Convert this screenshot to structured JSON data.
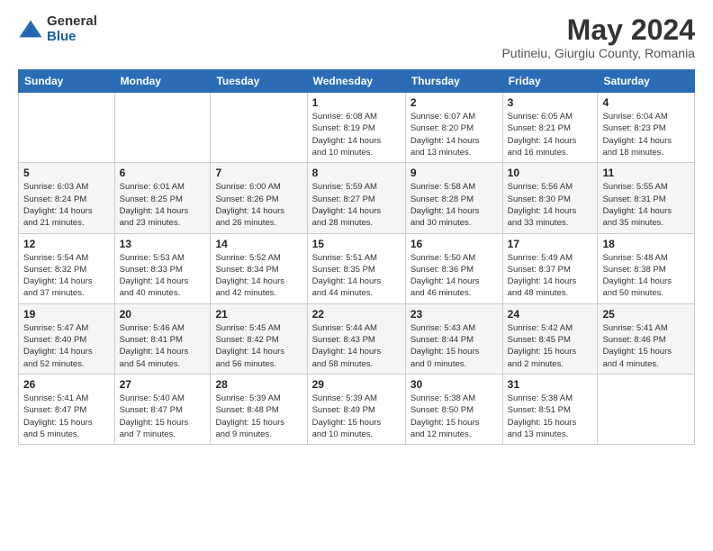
{
  "header": {
    "logo_general": "General",
    "logo_blue": "Blue",
    "month_title": "May 2024",
    "location": "Putineiu, Giurgiu County, Romania"
  },
  "weekdays": [
    "Sunday",
    "Monday",
    "Tuesday",
    "Wednesday",
    "Thursday",
    "Friday",
    "Saturday"
  ],
  "weeks": [
    [
      {
        "day": "",
        "detail": ""
      },
      {
        "day": "",
        "detail": ""
      },
      {
        "day": "",
        "detail": ""
      },
      {
        "day": "1",
        "detail": "Sunrise: 6:08 AM\nSunset: 8:19 PM\nDaylight: 14 hours\nand 10 minutes."
      },
      {
        "day": "2",
        "detail": "Sunrise: 6:07 AM\nSunset: 8:20 PM\nDaylight: 14 hours\nand 13 minutes."
      },
      {
        "day": "3",
        "detail": "Sunrise: 6:05 AM\nSunset: 8:21 PM\nDaylight: 14 hours\nand 16 minutes."
      },
      {
        "day": "4",
        "detail": "Sunrise: 6:04 AM\nSunset: 8:23 PM\nDaylight: 14 hours\nand 18 minutes."
      }
    ],
    [
      {
        "day": "5",
        "detail": "Sunrise: 6:03 AM\nSunset: 8:24 PM\nDaylight: 14 hours\nand 21 minutes."
      },
      {
        "day": "6",
        "detail": "Sunrise: 6:01 AM\nSunset: 8:25 PM\nDaylight: 14 hours\nand 23 minutes."
      },
      {
        "day": "7",
        "detail": "Sunrise: 6:00 AM\nSunset: 8:26 PM\nDaylight: 14 hours\nand 26 minutes."
      },
      {
        "day": "8",
        "detail": "Sunrise: 5:59 AM\nSunset: 8:27 PM\nDaylight: 14 hours\nand 28 minutes."
      },
      {
        "day": "9",
        "detail": "Sunrise: 5:58 AM\nSunset: 8:28 PM\nDaylight: 14 hours\nand 30 minutes."
      },
      {
        "day": "10",
        "detail": "Sunrise: 5:56 AM\nSunset: 8:30 PM\nDaylight: 14 hours\nand 33 minutes."
      },
      {
        "day": "11",
        "detail": "Sunrise: 5:55 AM\nSunset: 8:31 PM\nDaylight: 14 hours\nand 35 minutes."
      }
    ],
    [
      {
        "day": "12",
        "detail": "Sunrise: 5:54 AM\nSunset: 8:32 PM\nDaylight: 14 hours\nand 37 minutes."
      },
      {
        "day": "13",
        "detail": "Sunrise: 5:53 AM\nSunset: 8:33 PM\nDaylight: 14 hours\nand 40 minutes."
      },
      {
        "day": "14",
        "detail": "Sunrise: 5:52 AM\nSunset: 8:34 PM\nDaylight: 14 hours\nand 42 minutes."
      },
      {
        "day": "15",
        "detail": "Sunrise: 5:51 AM\nSunset: 8:35 PM\nDaylight: 14 hours\nand 44 minutes."
      },
      {
        "day": "16",
        "detail": "Sunrise: 5:50 AM\nSunset: 8:36 PM\nDaylight: 14 hours\nand 46 minutes."
      },
      {
        "day": "17",
        "detail": "Sunrise: 5:49 AM\nSunset: 8:37 PM\nDaylight: 14 hours\nand 48 minutes."
      },
      {
        "day": "18",
        "detail": "Sunrise: 5:48 AM\nSunset: 8:38 PM\nDaylight: 14 hours\nand 50 minutes."
      }
    ],
    [
      {
        "day": "19",
        "detail": "Sunrise: 5:47 AM\nSunset: 8:40 PM\nDaylight: 14 hours\nand 52 minutes."
      },
      {
        "day": "20",
        "detail": "Sunrise: 5:46 AM\nSunset: 8:41 PM\nDaylight: 14 hours\nand 54 minutes."
      },
      {
        "day": "21",
        "detail": "Sunrise: 5:45 AM\nSunset: 8:42 PM\nDaylight: 14 hours\nand 56 minutes."
      },
      {
        "day": "22",
        "detail": "Sunrise: 5:44 AM\nSunset: 8:43 PM\nDaylight: 14 hours\nand 58 minutes."
      },
      {
        "day": "23",
        "detail": "Sunrise: 5:43 AM\nSunset: 8:44 PM\nDaylight: 15 hours\nand 0 minutes."
      },
      {
        "day": "24",
        "detail": "Sunrise: 5:42 AM\nSunset: 8:45 PM\nDaylight: 15 hours\nand 2 minutes."
      },
      {
        "day": "25",
        "detail": "Sunrise: 5:41 AM\nSunset: 8:46 PM\nDaylight: 15 hours\nand 4 minutes."
      }
    ],
    [
      {
        "day": "26",
        "detail": "Sunrise: 5:41 AM\nSunset: 8:47 PM\nDaylight: 15 hours\nand 5 minutes."
      },
      {
        "day": "27",
        "detail": "Sunrise: 5:40 AM\nSunset: 8:47 PM\nDaylight: 15 hours\nand 7 minutes."
      },
      {
        "day": "28",
        "detail": "Sunrise: 5:39 AM\nSunset: 8:48 PM\nDaylight: 15 hours\nand 9 minutes."
      },
      {
        "day": "29",
        "detail": "Sunrise: 5:39 AM\nSunset: 8:49 PM\nDaylight: 15 hours\nand 10 minutes."
      },
      {
        "day": "30",
        "detail": "Sunrise: 5:38 AM\nSunset: 8:50 PM\nDaylight: 15 hours\nand 12 minutes."
      },
      {
        "day": "31",
        "detail": "Sunrise: 5:38 AM\nSunset: 8:51 PM\nDaylight: 15 hours\nand 13 minutes."
      },
      {
        "day": "",
        "detail": ""
      }
    ]
  ]
}
